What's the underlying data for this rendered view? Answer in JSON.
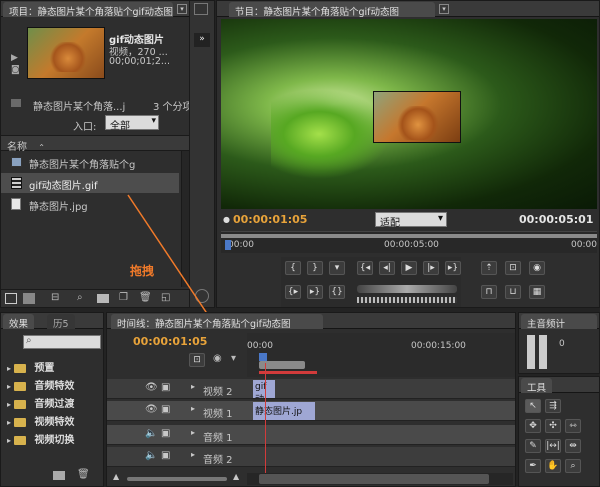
{
  "project": {
    "tab_title": "项目：静态图片某个角落贴个gif动态图",
    "preview_name": "gif动态图片",
    "preview_type": "视频，270 ...",
    "preview_time": "00;00;01;2...",
    "folder_name": "静态图片某个角落...j",
    "item_count": "3 个分项",
    "entry_label": "入口:",
    "entry_value": "全部",
    "column_name": "名称",
    "items": [
      {
        "label": "静态图片某个角落贴个g"
      },
      {
        "label": "gif动态图片.gif"
      },
      {
        "label": "静态图片.jpg"
      }
    ]
  },
  "program": {
    "tab_title": "节目：静态图片某个角落贴个gif动态图",
    "timecode_current": "00:00:01:05",
    "fit_label": "适配",
    "timecode_total": "00:00:05:01",
    "ruler_start": ":00:00",
    "ruler_mid": "00:00:05:00",
    "ruler_end": "00:00"
  },
  "annotation": {
    "drag_label": "拖拽"
  },
  "effects": {
    "tab_effects": "效果",
    "tab_history": "历5",
    "items": [
      {
        "label": "预置"
      },
      {
        "label": "音频特效"
      },
      {
        "label": "音频过渡"
      },
      {
        "label": "视频特效"
      },
      {
        "label": "视频切换"
      }
    ]
  },
  "timeline": {
    "tab_title": "时间线：静态图片某个角落贴个gif动态图",
    "timecode": "00:00:01:05",
    "ruler_start": "00:00",
    "ruler_mid": "00:00:15:00",
    "tracks": [
      {
        "label": "视频 2",
        "clip": "gif动"
      },
      {
        "label": "视频 1",
        "clip": "静态图片.jp"
      },
      {
        "label": "音频 1",
        "clip": ""
      },
      {
        "label": "音频 2",
        "clip": ""
      }
    ]
  },
  "audio_meter": {
    "tab_title": "主音频计",
    "level": "0"
  },
  "tools": {
    "tab_title": "工具"
  },
  "colors": {
    "accent_timecode": "#e8a33a",
    "playhead": "#d23b3b",
    "drag_arrow": "#f07a2a"
  }
}
